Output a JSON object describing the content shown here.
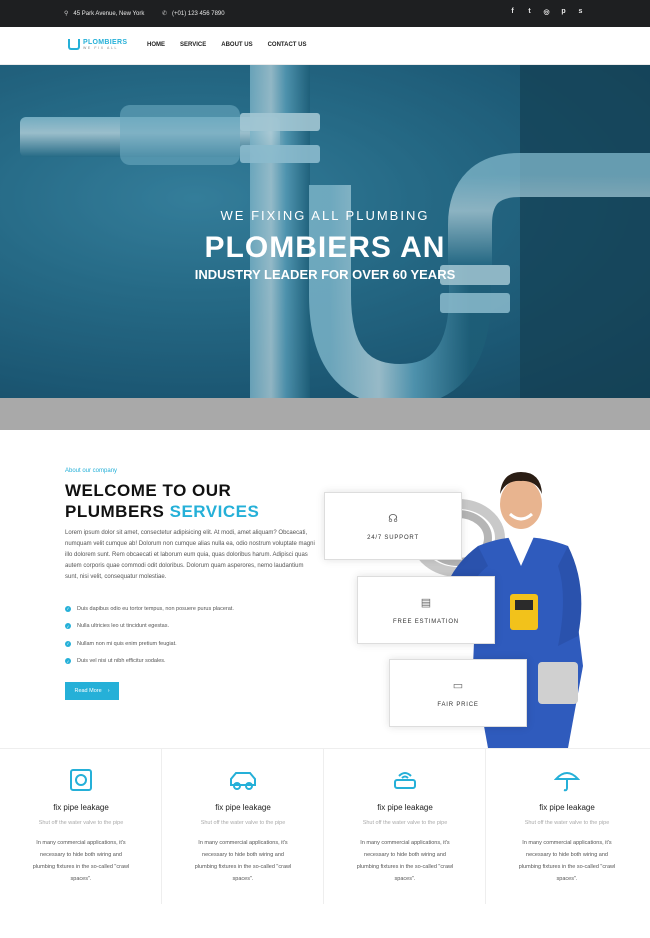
{
  "topbar": {
    "address": "45 Park Avenue, New York",
    "phone": "(+01) 123 456 7890",
    "social_icons": [
      "facebook-icon",
      "twitter-icon",
      "instagram-icon",
      "pinterest-icon",
      "skype-icon"
    ],
    "social_glyphs": [
      "f",
      "t",
      "◎",
      "p",
      "s"
    ]
  },
  "nav": {
    "logo_name": "PLOMBIERS",
    "logo_tagline": "WE FIX ALL",
    "items": [
      "HOME",
      "SERVICE",
      "ABOUT US",
      "CONTACT US"
    ]
  },
  "hero": {
    "subtitle": "WE FIXING ALL PLUMBING",
    "title": "PLOMBIERS AN",
    "line": "INDUSTRY LEADER FOR OVER 60 YEARS"
  },
  "welcome": {
    "eyebrow": "About our company",
    "heading_line1": "WELCOME TO OUR",
    "heading_line2_plain": "PLUMBERS ",
    "heading_line2_accent": "SERVICES",
    "paragraph": "Lorem ipsum dolor sit amet, consectetur adipisicing elit. At modi, amet aliquam? Obcaecati, numquam velit cumque ab! Dolorum non cumque alias nulla ea, odio nostrum voluptate magni illo dolorem sunt. Rem obcaecati et laborum eum quia, quas doloribus harum. Adipisci quas autem corporis quae commodi odit doloribus. Dolorum quam asperores, nemo laudantium sunt, nisi velit, consequatur molestiae.",
    "checklist": [
      "Duis dapibus odio eu tortor tempus, non posuere purus placerat.",
      "Nulla ultricies leo ut tincidunt egestas.",
      "Nullam non mi quis enim pretium feugiat.",
      "Duis vel nisi ut nibh efficitur sodales."
    ],
    "button": "Read More"
  },
  "features": [
    {
      "label": "24/7 SUPPORT",
      "icon": "headset-icon"
    },
    {
      "label": "FREE ESTIMATION",
      "icon": "document-icon"
    },
    {
      "label": "FAIR PRICE",
      "icon": "cash-icon"
    }
  ],
  "services": [
    {
      "title": "fix pipe leakage",
      "icon": "safe-icon",
      "sub": "Shut off the water valve to the pipe",
      "desc": "In many commercial applications, it's necessary to hide both wiring and plumbing fixtures in the so-called \"crawl spaces\"."
    },
    {
      "title": "fix pipe leakage",
      "icon": "car-icon",
      "sub": "Shut off the water valve to the pipe",
      "desc": "In many commercial applications, it's necessary to hide both wiring and plumbing fixtures in the so-called \"crawl spaces\"."
    },
    {
      "title": "fix pipe leakage",
      "icon": "router-icon",
      "sub": "Shut off the water valve to the pipe",
      "desc": "In many commercial applications, it's necessary to hide both wiring and plumbing fixtures in the so-called \"crawl spaces\"."
    },
    {
      "title": "fix pipe leakage",
      "icon": "umbrella-icon",
      "sub": "Shut off the water valve to the pipe",
      "desc": "In many commercial applications, it's necessary to hide both wiring and plumbing fixtures in the so-called \"crawl spaces\"."
    }
  ],
  "colors": {
    "accent": "#25b0d8",
    "topbar": "#1e1f21",
    "hero": "#2b6f8c"
  }
}
